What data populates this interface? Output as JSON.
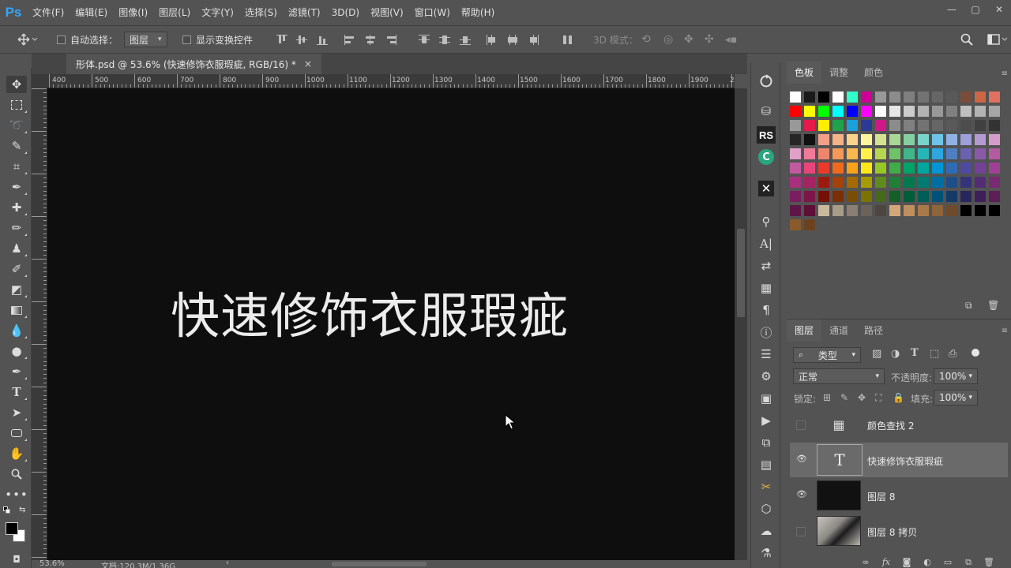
{
  "app": {
    "logo": "Ps"
  },
  "menubar": {
    "items": [
      "文件(F)",
      "编辑(E)",
      "图像(I)",
      "图层(L)",
      "文字(Y)",
      "选择(S)",
      "滤镜(T)",
      "3D(D)",
      "视图(V)",
      "窗口(W)",
      "帮助(H)"
    ]
  },
  "window_controls": {
    "minimize": "—",
    "restore": "▢",
    "close": "✕"
  },
  "options_bar": {
    "auto_select_label": "自动选择：",
    "auto_select_target": "图层",
    "show_transform_label": "显示变换控件",
    "mode_3d_label": "3D 模式："
  },
  "document": {
    "tab_title": "形体.psd @ 53.6% (快速修饰衣服瑕疵, RGB/16) *",
    "close_glyph": "×",
    "canvas_text": "快速修饰衣服瑕疵",
    "ruler_labels": [
      "400",
      "500",
      "600",
      "700",
      "800",
      "900",
      "1000",
      "1100",
      "1200",
      "1300",
      "1400",
      "1500",
      "1600",
      "1700",
      "1800",
      "1900",
      "2"
    ]
  },
  "status": {
    "zoom": "53.6%",
    "doc_info": "文档:120.3M/1.36G"
  },
  "color_panel": {
    "tabs": [
      "色板",
      "调整",
      "颜色"
    ],
    "active_tab": "色板",
    "swatch_rows": [
      [
        "#ffffff",
        "#1a1a1a",
        "#000000",
        "#ffffff",
        "#33ffcc",
        "#cc0099",
        "#999999",
        "#8c8c8c",
        "#7f7f7f",
        "#737373",
        "#666666",
        "#595959",
        "#7a4d3a",
        "#cc6644",
        "#e07060"
      ],
      [
        "#ff0000",
        "#ffff00",
        "#00ff00",
        "#00ffff",
        "#0000ff",
        "#ff00ff",
        "#ffffff",
        "#e6e6e6",
        "#cccccc",
        "#b3b3b3",
        "#999999",
        "#808080",
        "#bfbfbf",
        "#b3b3b3",
        "#a6a6a6"
      ],
      [
        "#999999",
        "#e6194b",
        "#ffee00",
        "#1fa34a",
        "#1aa1db",
        "#2b3a97",
        "#d0178a",
        "#8c8c8c",
        "#808080",
        "#737373",
        "#666666",
        "#595959",
        "#4d4d4d",
        "#404040",
        "#333333"
      ],
      [
        "#262626",
        "#111111",
        "#f2a088",
        "#f5b38a",
        "#fbd28c",
        "#fff59d",
        "#d4e38f",
        "#a8d893",
        "#83cfa1",
        "#7ad3c8",
        "#6ec4e8",
        "#8fb2e3",
        "#9d9fd6",
        "#b59ad1",
        "#d49cc8"
      ],
      [
        "#e0a0c8",
        "#f07a9a",
        "#f0856e",
        "#f5995a",
        "#fbb84f",
        "#fff14a",
        "#b6d64f",
        "#6fc266",
        "#3fb78b",
        "#26b6b8",
        "#2ea6e0",
        "#4f7fc2",
        "#6a62b0",
        "#8a5aa8",
        "#b45aa0"
      ],
      [
        "#c25aa0",
        "#e8457a",
        "#ea3a2c",
        "#f06a1e",
        "#f8a21c",
        "#ffe81a",
        "#98c824",
        "#41ad48",
        "#00a466",
        "#00a79d",
        "#0096d6",
        "#2f6ab5",
        "#4d4aa0",
        "#744098",
        "#a13f95"
      ],
      [
        "#a8307f",
        "#a52363",
        "#9c1b10",
        "#a3420a",
        "#a66a05",
        "#a69c00",
        "#5f8b1c",
        "#1f7f37",
        "#007a4d",
        "#007b72",
        "#006ea0",
        "#1e4e8a",
        "#35347a",
        "#542c76",
        "#7a2a72"
      ],
      [
        "#7b1e60",
        "#7d1549",
        "#741006",
        "#7a3005",
        "#7a4e02",
        "#7a7300",
        "#46691a",
        "#145e28",
        "#005c39",
        "#005d57",
        "#005279",
        "#163a68",
        "#27275c",
        "#3f1f59",
        "#5c1f56"
      ],
      [
        "#5e1648",
        "#5e0f36",
        "#c8b89c",
        "#a89c8a",
        "#8a7f72",
        "#6b625a",
        "#4d4640",
        "#d4a77a",
        "#c08f5e",
        "#a87a4a",
        "#8e643a",
        "#6e4b2b",
        "#000000",
        "#000000",
        "#000000"
      ],
      [
        "#8a5a2b",
        "#6b4220"
      ]
    ]
  },
  "layers_panel": {
    "tabs": [
      "图层",
      "通道",
      "路径"
    ],
    "active_tab": "图层",
    "filter_label": "类型",
    "blend_mode": "正常",
    "opacity_label": "不透明度:",
    "opacity_value": "100%",
    "lock_label": "锁定:",
    "fill_label": "填充:",
    "fill_value": "100%",
    "layers": [
      {
        "name": "颜色查找 2",
        "visible": false,
        "kind": "adjustment"
      },
      {
        "name": "快速修饰衣服瑕疵",
        "visible": true,
        "kind": "text",
        "selected": true
      },
      {
        "name": "图层 8",
        "visible": true,
        "kind": "fill"
      },
      {
        "name": "图层 8 拷贝",
        "visible": false,
        "kind": "photo"
      }
    ]
  }
}
